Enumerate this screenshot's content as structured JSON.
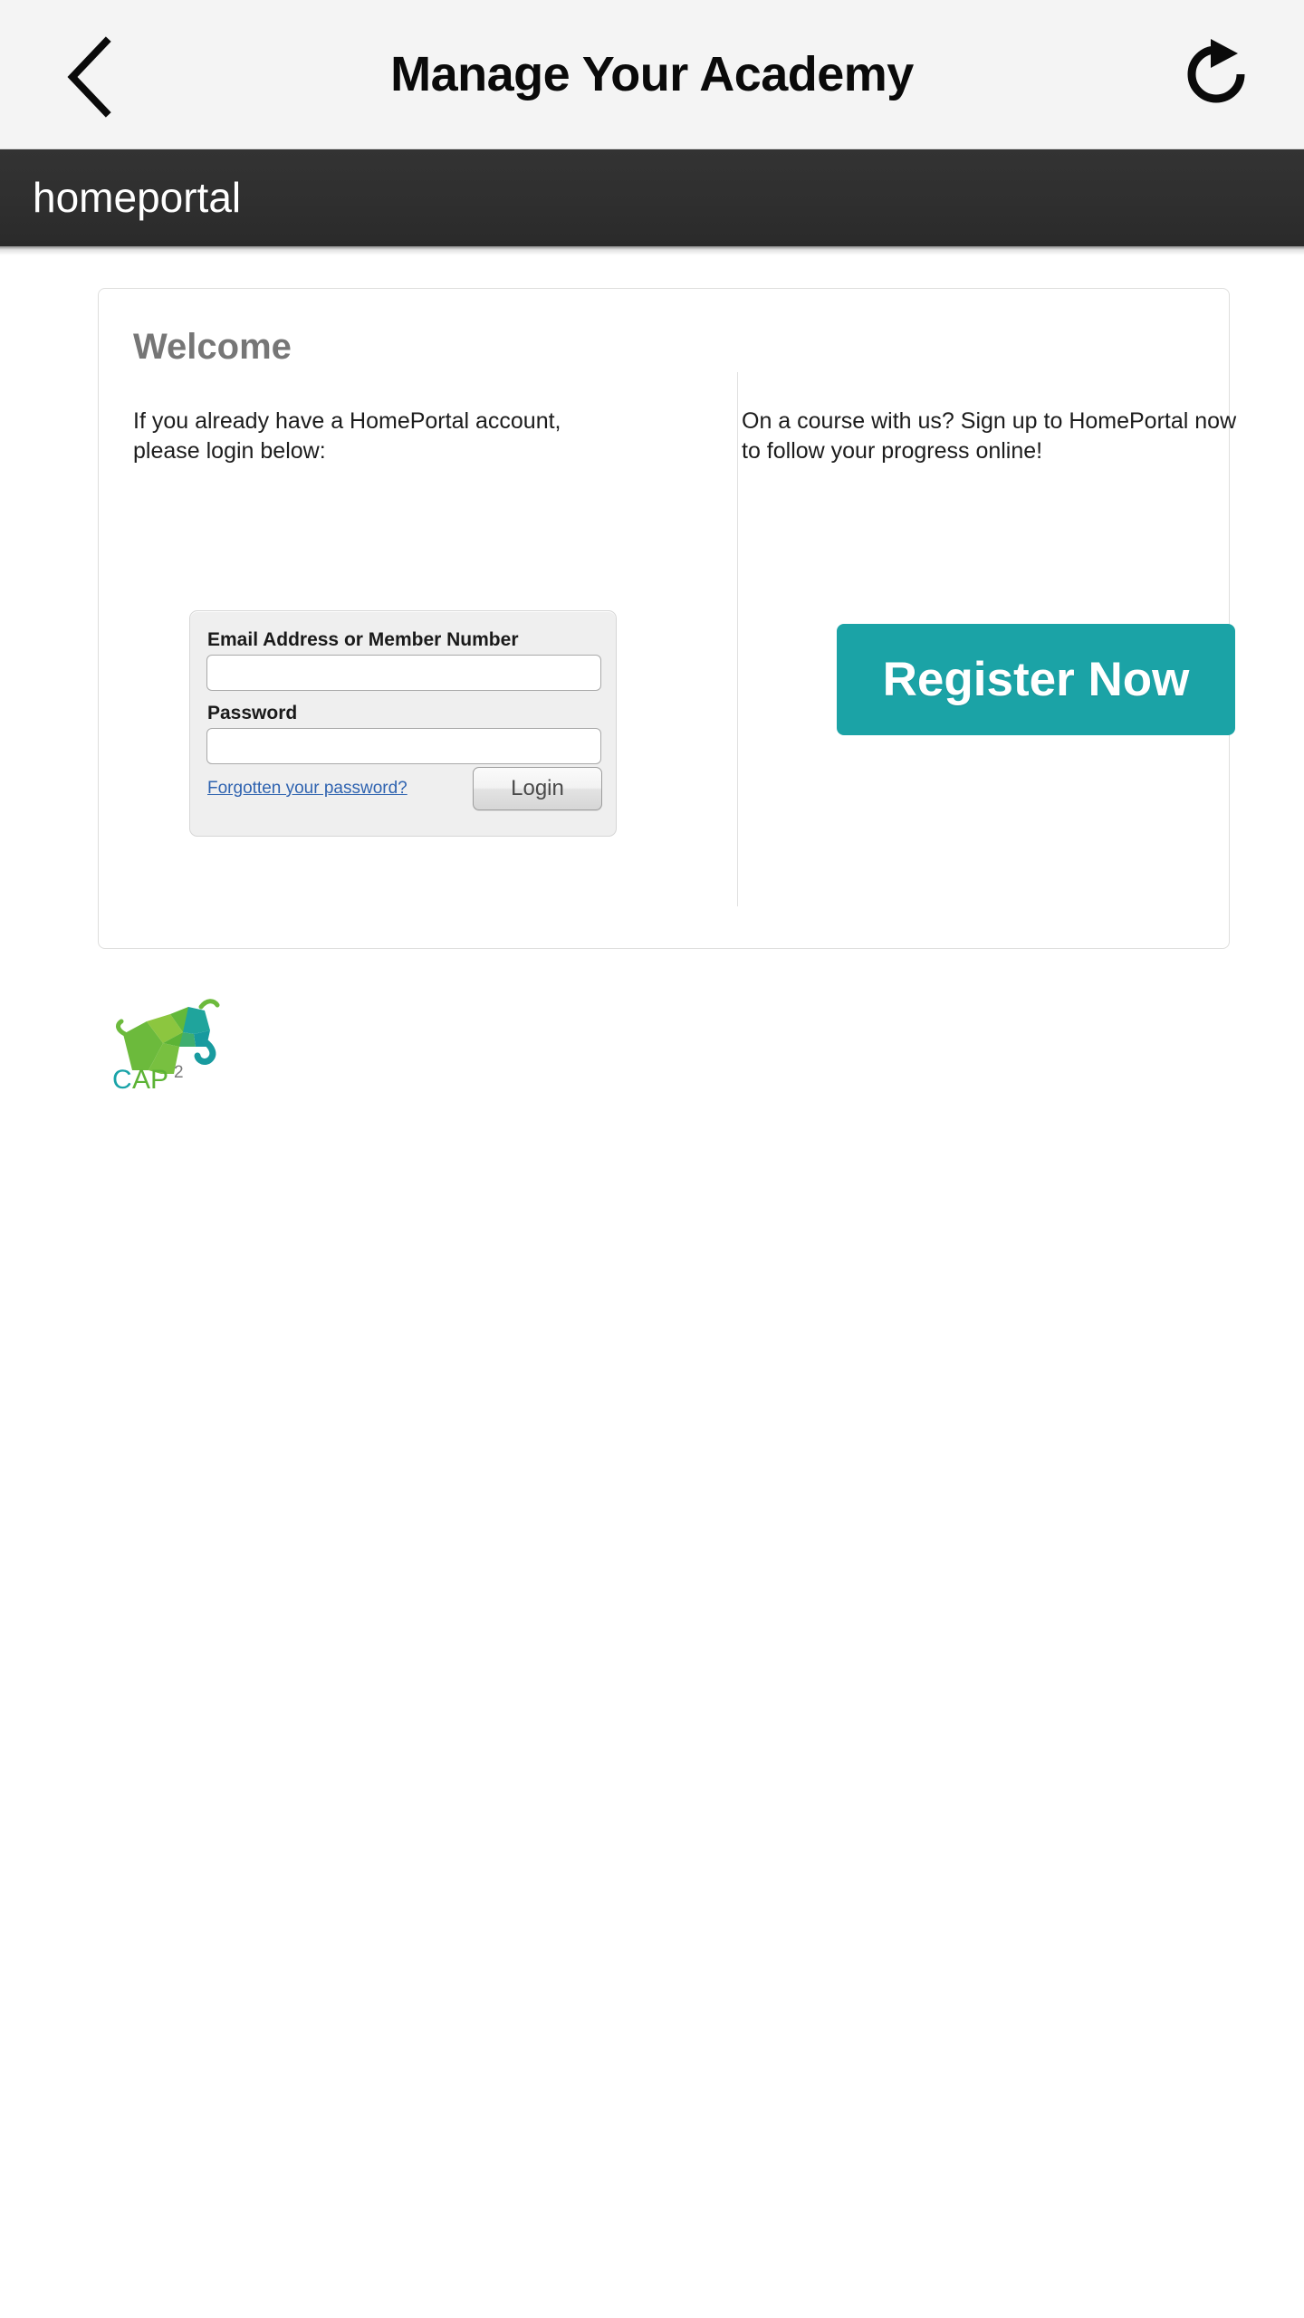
{
  "header": {
    "title": "Manage Your Academy",
    "back_icon": "chevron-left-icon",
    "reload_icon": "reload-icon"
  },
  "site_bar": {
    "brand": "homeportal",
    "background_color": "#2f2f2f"
  },
  "card": {
    "heading": "Welcome",
    "left_column": {
      "intro": "If you already have a HomePortal account, please login below:",
      "form": {
        "email_label": "Email Address or Member Number",
        "email_value": "",
        "email_placeholder": "",
        "password_label": "Password",
        "password_value": "",
        "password_placeholder": "",
        "forgot_link": "Forgotten your password?",
        "login_button": "Login"
      }
    },
    "right_column": {
      "promo": "On a course with us? Sign up to HomePortal now to follow your progress online!",
      "register_button": "Register Now",
      "register_button_color": "#1ba3a6"
    }
  },
  "footer": {
    "logo_name": "cap2-elephant-logo",
    "logo_text_c": "C",
    "logo_text_ap": "AP",
    "logo_text_sup": "2",
    "logo_colors": {
      "teal": "#19a3a8",
      "green": "#5cb335",
      "light_green": "#8cc63f",
      "gray": "#7a7a7a"
    }
  }
}
